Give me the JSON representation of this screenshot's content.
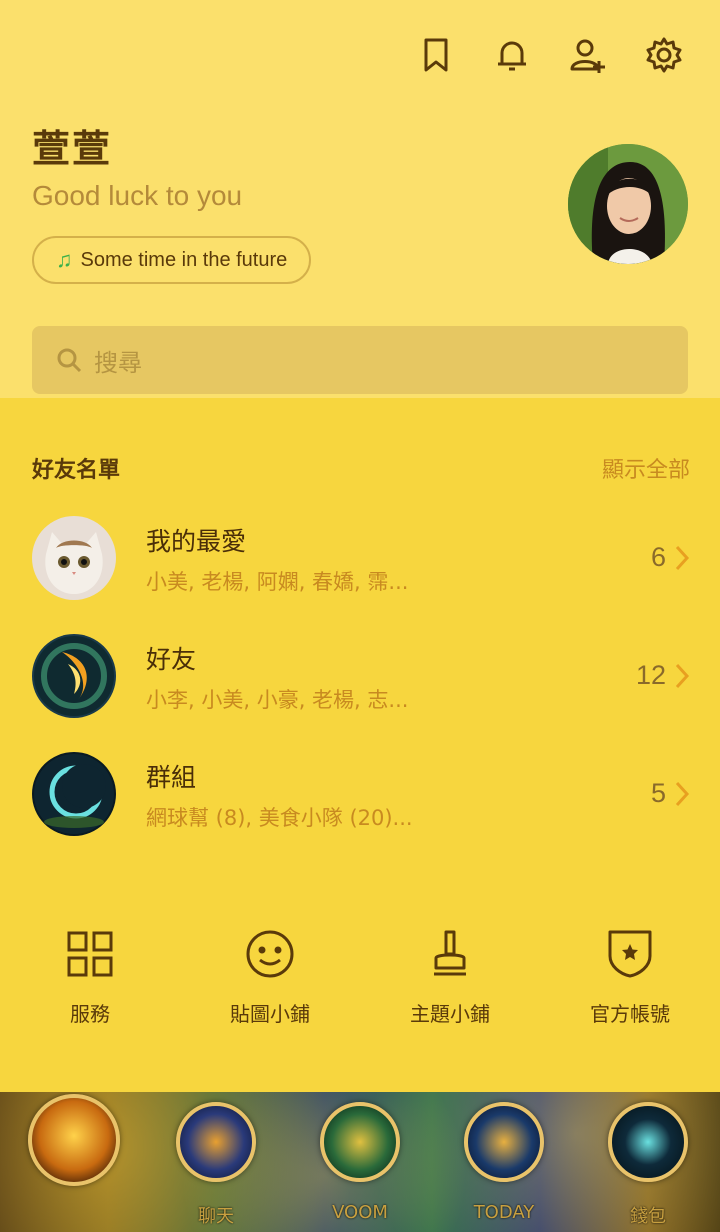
{
  "profile": {
    "name": "萱萱",
    "status_message": "Good luck to you",
    "music": "Some time in the future"
  },
  "search": {
    "placeholder": "搜尋"
  },
  "friends": {
    "title": "好友名單",
    "show_all": "顯示全部",
    "rows": [
      {
        "title": "我的最愛",
        "members": "小美, 老楊, 阿嫻, 春嬌, 霈...",
        "count": "6"
      },
      {
        "title": "好友",
        "members": "小李, 小美, 小豪, 老楊, 志...",
        "count": "12"
      },
      {
        "title": "群組",
        "members": "網球幫 (8), 美食小隊 (20)...",
        "count": "5"
      }
    ]
  },
  "shortcuts": [
    {
      "label": "服務",
      "icon": "grid-icon"
    },
    {
      "label": "貼圖小鋪",
      "icon": "smile-icon"
    },
    {
      "label": "主題小鋪",
      "icon": "brush-icon"
    },
    {
      "label": "官方帳號",
      "icon": "shield-star-icon"
    }
  ],
  "tabs": [
    {
      "label": "",
      "icon": "friends-tab-icon"
    },
    {
      "label": "聊天",
      "icon": "chat-tab-icon"
    },
    {
      "label": "VOOM",
      "icon": "voom-tab-icon"
    },
    {
      "label": "TODAY",
      "icon": "today-tab-icon"
    },
    {
      "label": "錢包",
      "icon": "wallet-tab-icon"
    }
  ],
  "colors": {
    "header_bg": "#fbe06c",
    "body_bg": "#f7d63e",
    "accent_orange": "#c88a20",
    "text_brown": "#5a3a0a"
  }
}
